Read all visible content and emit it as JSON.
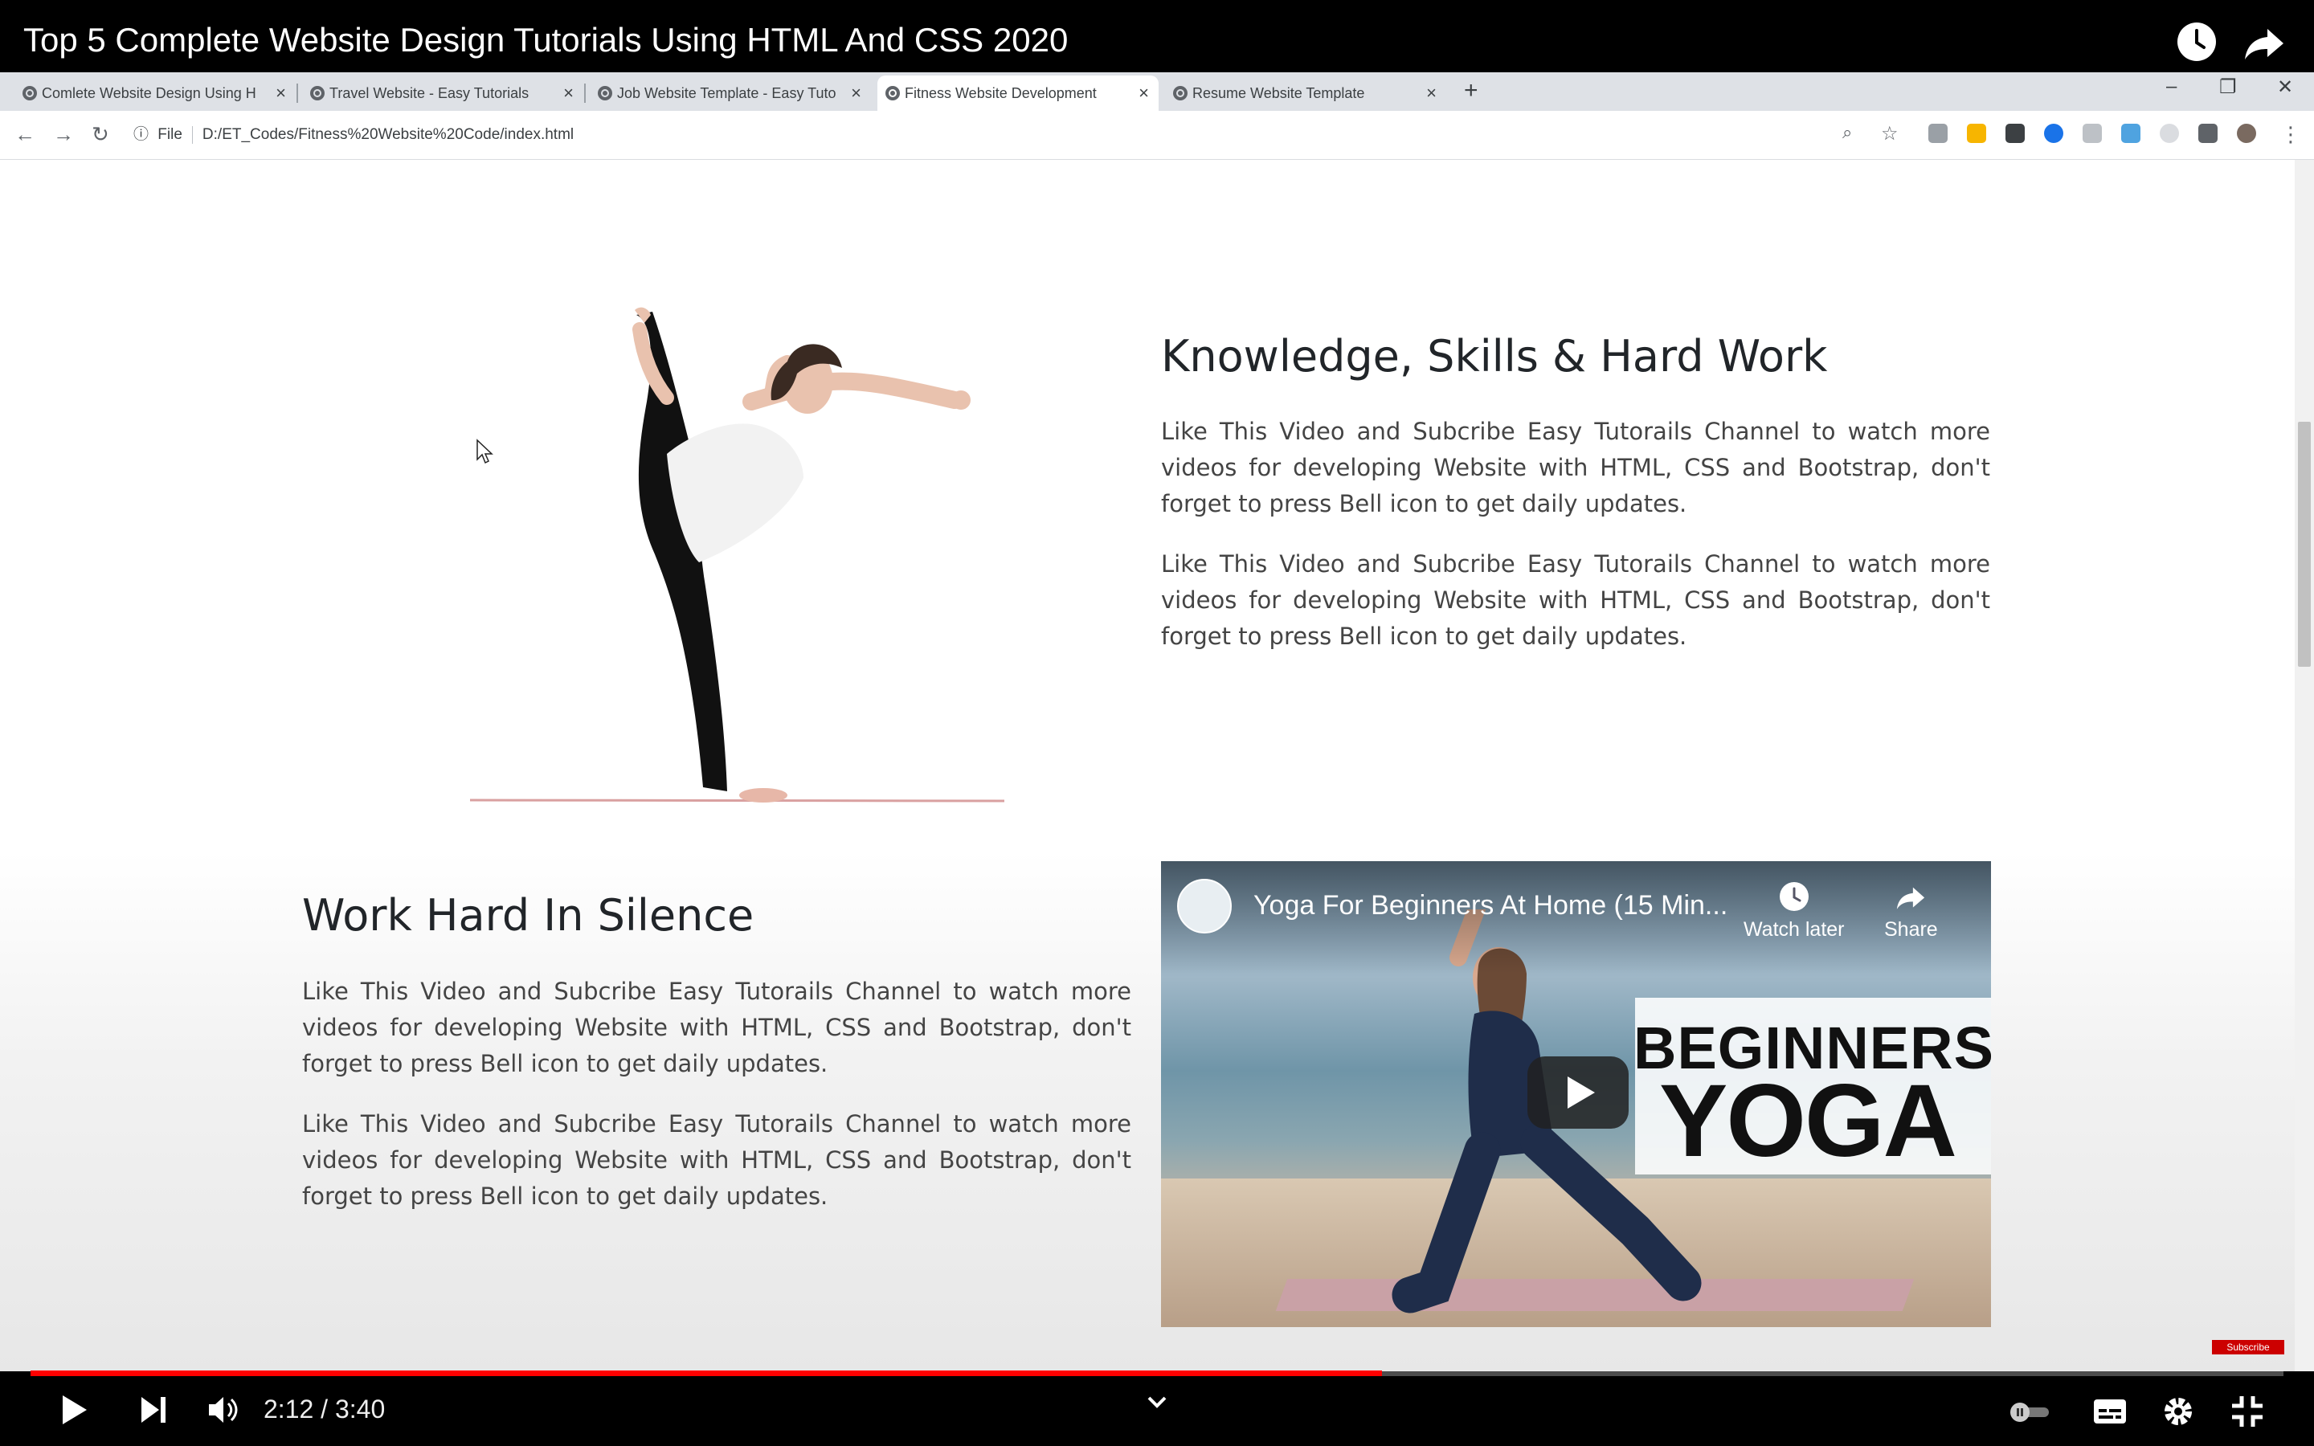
{
  "video": {
    "title": "Top 5 Complete Website Design Tutorials Using HTML And CSS 2020",
    "time": "2:12 / 3:40",
    "progress": 0.6,
    "subscribe_badge": "Subscribe"
  },
  "browser": {
    "tabs": [
      {
        "label": "Comlete Website Design Using H",
        "active": false
      },
      {
        "label": "Travel Website - Easy Tutorials",
        "active": false
      },
      {
        "label": "Job Website Template - Easy Tuto",
        "active": false
      },
      {
        "label": "Fitness Website Development",
        "active": true
      },
      {
        "label": "Resume Website Template",
        "active": false
      }
    ],
    "address": {
      "scheme": "File",
      "url": "D:/ET_Codes/Fitness%20Website%20Code/index.html"
    }
  },
  "page": {
    "section1": {
      "heading": "Knowledge, Skills & Hard Work",
      "para1": "Like This Video and Subcribe Easy Tutorails Channel to watch more videos for developing Website with HTML, CSS and Bootstrap, don't forget to press Bell icon to get daily updates.",
      "para2": "Like This Video and Subcribe Easy Tutorails Channel to watch more videos for developing Website with HTML, CSS and Bootstrap, don't forget to press Bell icon to get daily updates."
    },
    "section2": {
      "heading": "Work Hard In Silence",
      "para1": "Like This Video and Subcribe Easy Tutorails Channel to watch more videos for developing Website with HTML, CSS and Bootstrap, don't forget to press Bell icon to get daily updates.",
      "para2": "Like This Video and Subcribe Easy Tutorails Channel to watch more videos for developing Website with HTML, CSS and Bootstrap, don't forget to press Bell icon to get daily updates."
    },
    "embed": {
      "title": "Yoga For Beginners At Home (15 Min...",
      "watch_later": "Watch later",
      "share": "Share",
      "thumb_line1": "BEGINNERS",
      "thumb_line2": "YOGA"
    }
  },
  "colors": {
    "progress": "#ff0000",
    "chrome_tabstrip": "#dee1e6"
  }
}
